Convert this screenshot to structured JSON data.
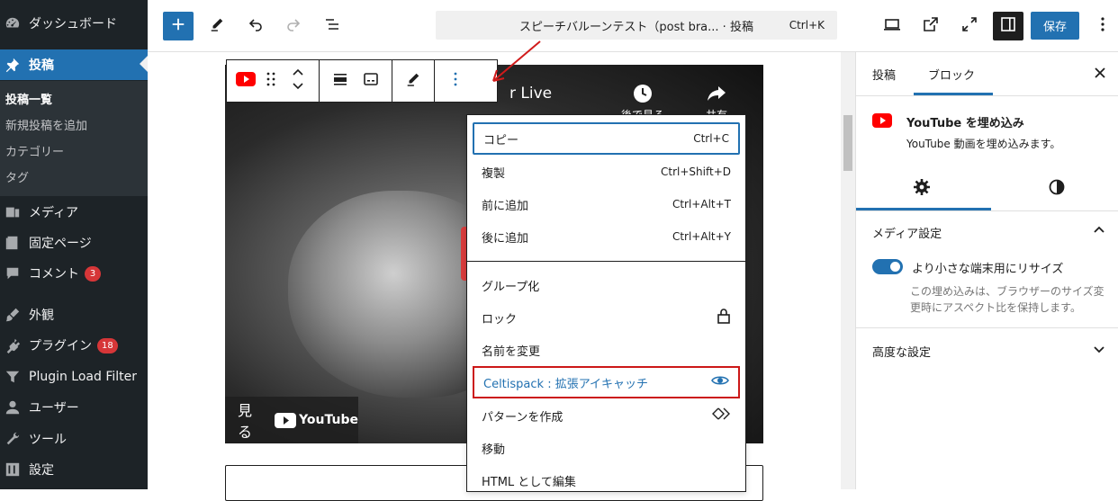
{
  "sidebar": {
    "dashboard": "ダッシュボード",
    "posts": "投稿",
    "posts_sub": [
      "投稿一覧",
      "新規投稿を追加",
      "カテゴリー",
      "タグ"
    ],
    "media": "メディア",
    "pages": "固定ページ",
    "comments": "コメント",
    "comments_badge": "3",
    "appearance": "外観",
    "plugins": "プラグイン",
    "plugins_badge": "18",
    "plugin_load_filter": "Plugin Load Filter",
    "users": "ユーザー",
    "tools": "ツール",
    "settings": "設定"
  },
  "topbar": {
    "command_title": "スピーチバルーンテスト（post bra... · 投稿",
    "command_shortcut": "Ctrl+K",
    "save_label": "保存"
  },
  "video": {
    "live_text": "r Live",
    "watch_later": "後で見る",
    "share": "共有",
    "watch_on": "見る",
    "youtube_word": "YouTube"
  },
  "dropdown": {
    "items": [
      {
        "label": "コピー",
        "shortcut": "Ctrl+C"
      },
      {
        "label": "複製",
        "shortcut": "Ctrl+Shift+D"
      },
      {
        "label": "前に追加",
        "shortcut": "Ctrl+Alt+T"
      },
      {
        "label": "後に追加",
        "shortcut": "Ctrl+Alt+Y"
      },
      {
        "label": "グループ化",
        "shortcut": ""
      },
      {
        "label": "ロック",
        "shortcut": ""
      },
      {
        "label": "名前を変更",
        "shortcut": ""
      },
      {
        "label": "Celtispack : 拡張アイキャッチ",
        "shortcut": ""
      },
      {
        "label": "パターンを作成",
        "shortcut": ""
      },
      {
        "label": "移動",
        "shortcut": ""
      },
      {
        "label": "HTML として編集",
        "shortcut": ""
      }
    ]
  },
  "settings_panel": {
    "tab_post": "投稿",
    "tab_block": "ブロック",
    "block_title": "YouTube を埋め込み",
    "block_desc": "YouTube 動画を埋め込みます。",
    "media_settings": "メディア設定",
    "toggle_label": "より小さな端末用にリサイズ",
    "toggle_help": "この埋め込みは、ブラウザーのサイズ変更時にアスペクト比を保持します。",
    "advanced": "高度な設定"
  },
  "colors": {
    "accent": "#2271b1",
    "sidebar_bg": "#1d2327",
    "highlight_border": "#cc1818",
    "youtube_red": "#ff0000"
  }
}
